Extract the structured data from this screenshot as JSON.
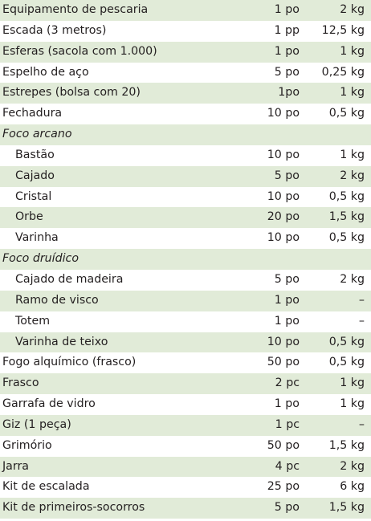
{
  "rows": [
    {
      "item": "Equipamento de pescaria",
      "cost": "1 po",
      "weight": "2 kg",
      "type": "item"
    },
    {
      "item": "Escada (3 metros)",
      "cost": "1 pp",
      "weight": "12,5 kg",
      "type": "item"
    },
    {
      "item": "Esferas (sacola com 1.000)",
      "cost": "1 po",
      "weight": "1 kg",
      "type": "item"
    },
    {
      "item": "Espelho de aço",
      "cost": "5 po",
      "weight": "0,25 kg",
      "type": "item"
    },
    {
      "item": "Estrepes (bolsa com 20)",
      "cost": "1po",
      "weight": "1 kg",
      "type": "item"
    },
    {
      "item": "Fechadura",
      "cost": "10 po",
      "weight": "0,5 kg",
      "type": "item"
    },
    {
      "item": "Foco arcano",
      "cost": "",
      "weight": "",
      "type": "cat"
    },
    {
      "item": "Bastão",
      "cost": "10 po",
      "weight": "1 kg",
      "type": "sub"
    },
    {
      "item": "Cajado",
      "cost": "5 po",
      "weight": "2 kg",
      "type": "sub"
    },
    {
      "item": "Cristal",
      "cost": "10 po",
      "weight": "0,5 kg",
      "type": "sub"
    },
    {
      "item": "Orbe",
      "cost": "20 po",
      "weight": "1,5 kg",
      "type": "sub"
    },
    {
      "item": "Varinha",
      "cost": "10 po",
      "weight": "0,5 kg",
      "type": "sub"
    },
    {
      "item": "Foco druídico",
      "cost": "",
      "weight": "",
      "type": "cat"
    },
    {
      "item": "Cajado de madeira",
      "cost": "5 po",
      "weight": "2 kg",
      "type": "sub"
    },
    {
      "item": "Ramo de visco",
      "cost": "1 po",
      "weight": "–",
      "type": "sub"
    },
    {
      "item": "Totem",
      "cost": "1 po",
      "weight": "–",
      "type": "sub"
    },
    {
      "item": "Varinha de teixo",
      "cost": "10 po",
      "weight": "0,5 kg",
      "type": "sub"
    },
    {
      "item": "Fogo alquímico (frasco)",
      "cost": "50 po",
      "weight": "0,5 kg",
      "type": "item"
    },
    {
      "item": "Frasco",
      "cost": "2 pc",
      "weight": "1 kg",
      "type": "item"
    },
    {
      "item": "Garrafa de vidro",
      "cost": "1 po",
      "weight": "1 kg",
      "type": "item"
    },
    {
      "item": "Giz (1 peça)",
      "cost": "1 pc",
      "weight": "–",
      "type": "item"
    },
    {
      "item": "Grimório",
      "cost": "50 po",
      "weight": "1,5 kg",
      "type": "item"
    },
    {
      "item": "Jarra",
      "cost": "4 pc",
      "weight": "2 kg",
      "type": "item"
    },
    {
      "item": "Kit de escalada",
      "cost": "25 po",
      "weight": "6 kg",
      "type": "item"
    },
    {
      "item": "Kit de primeiros-socorros",
      "cost": "5 po",
      "weight": "1,5 kg",
      "type": "item"
    }
  ],
  "colors": {
    "shaded_row": "#e1ebd8",
    "text": "#231f20"
  }
}
